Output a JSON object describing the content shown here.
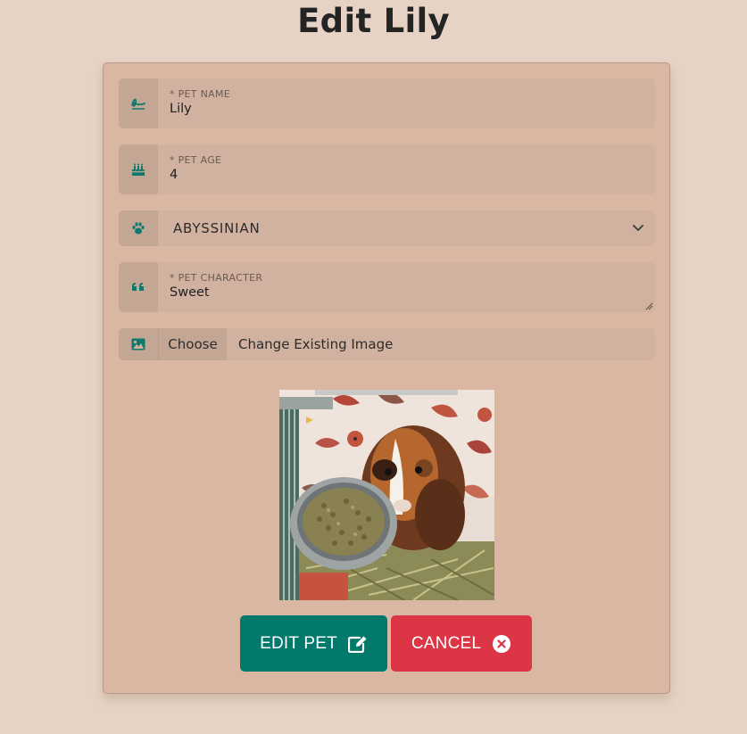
{
  "page": {
    "title": "Edit Lily"
  },
  "form": {
    "pet_name": {
      "label": "* PET NAME",
      "value": "Lily",
      "icon": "signature-icon"
    },
    "pet_age": {
      "label": "* PET AGE",
      "value": "4",
      "icon": "birthday-cake-icon"
    },
    "breed": {
      "selected": "ABYSSINIAN",
      "icon": "paw-icon"
    },
    "pet_character": {
      "label": "* PET CHARACTER",
      "value": "Sweet",
      "icon": "quote-icon"
    },
    "image": {
      "choose_label": "Choose",
      "text": "Change Existing Image",
      "icon": "image-icon"
    }
  },
  "actions": {
    "edit_label": "EDIT PET",
    "cancel_label": "CANCEL"
  },
  "colors": {
    "background": "#e7d3c5",
    "card": "#dab7a2",
    "accent": "#017a6c",
    "danger": "#dc3545"
  }
}
